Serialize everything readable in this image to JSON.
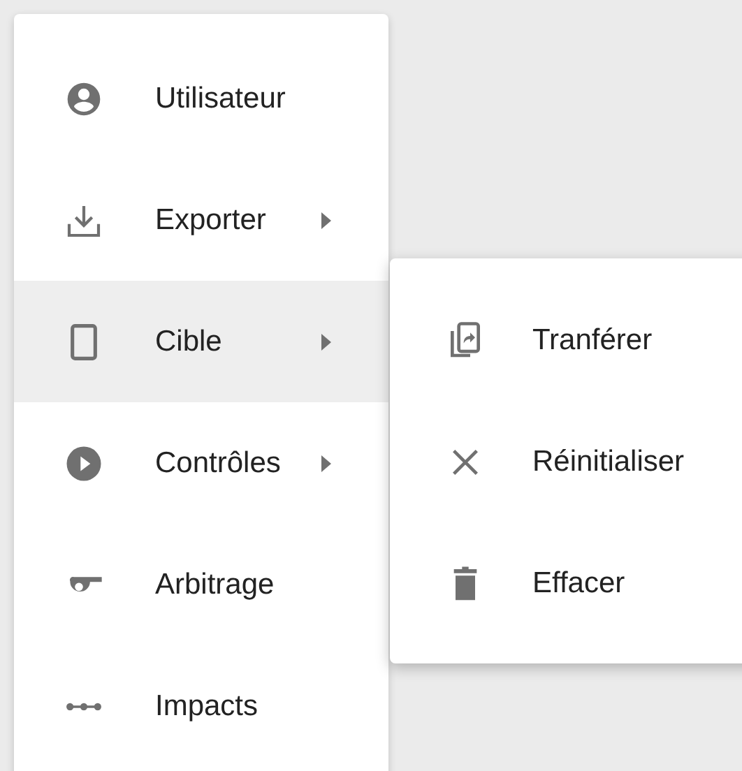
{
  "menu": {
    "items": [
      {
        "label": "Utilisateur",
        "has_submenu": false,
        "selected": false
      },
      {
        "label": "Exporter",
        "has_submenu": true,
        "selected": false
      },
      {
        "label": "Cible",
        "has_submenu": true,
        "selected": true
      },
      {
        "label": "Contrôles",
        "has_submenu": true,
        "selected": false
      },
      {
        "label": "Arbitrage",
        "has_submenu": false,
        "selected": false
      },
      {
        "label": "Impacts",
        "has_submenu": false,
        "selected": false
      }
    ]
  },
  "submenu": {
    "items": [
      {
        "label": "Tranférer"
      },
      {
        "label": "Réinitialiser"
      },
      {
        "label": "Effacer"
      }
    ]
  }
}
